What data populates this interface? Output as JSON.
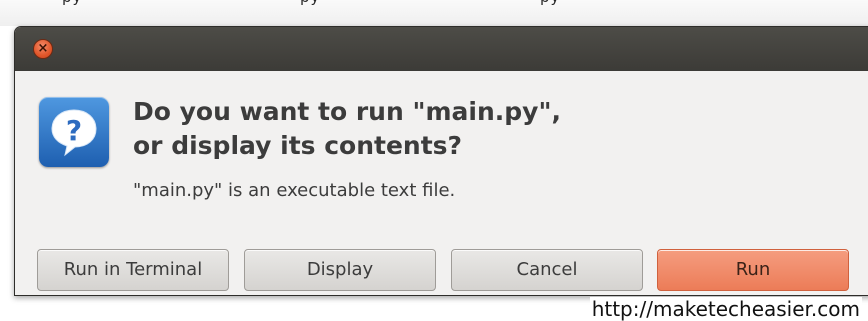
{
  "dialog": {
    "close_icon": "close-icon",
    "icon": "question-icon",
    "heading_line1": "Do you want to run \"main.py\",",
    "heading_line2": "or display its contents?",
    "subtext": "\"main.py\" is an executable text file.",
    "buttons": {
      "run_in_terminal": "Run in Terminal",
      "display": "Display",
      "cancel": "Cancel",
      "run": "Run"
    }
  },
  "watermark": "http://maketecheasier.com",
  "colors": {
    "titlebar": "#3c3b37",
    "dialog_bg": "#f2f1f0",
    "close_button": "#e0562a",
    "primary_button": "#ec7c58",
    "icon_blue": "#1e5fb0"
  }
}
